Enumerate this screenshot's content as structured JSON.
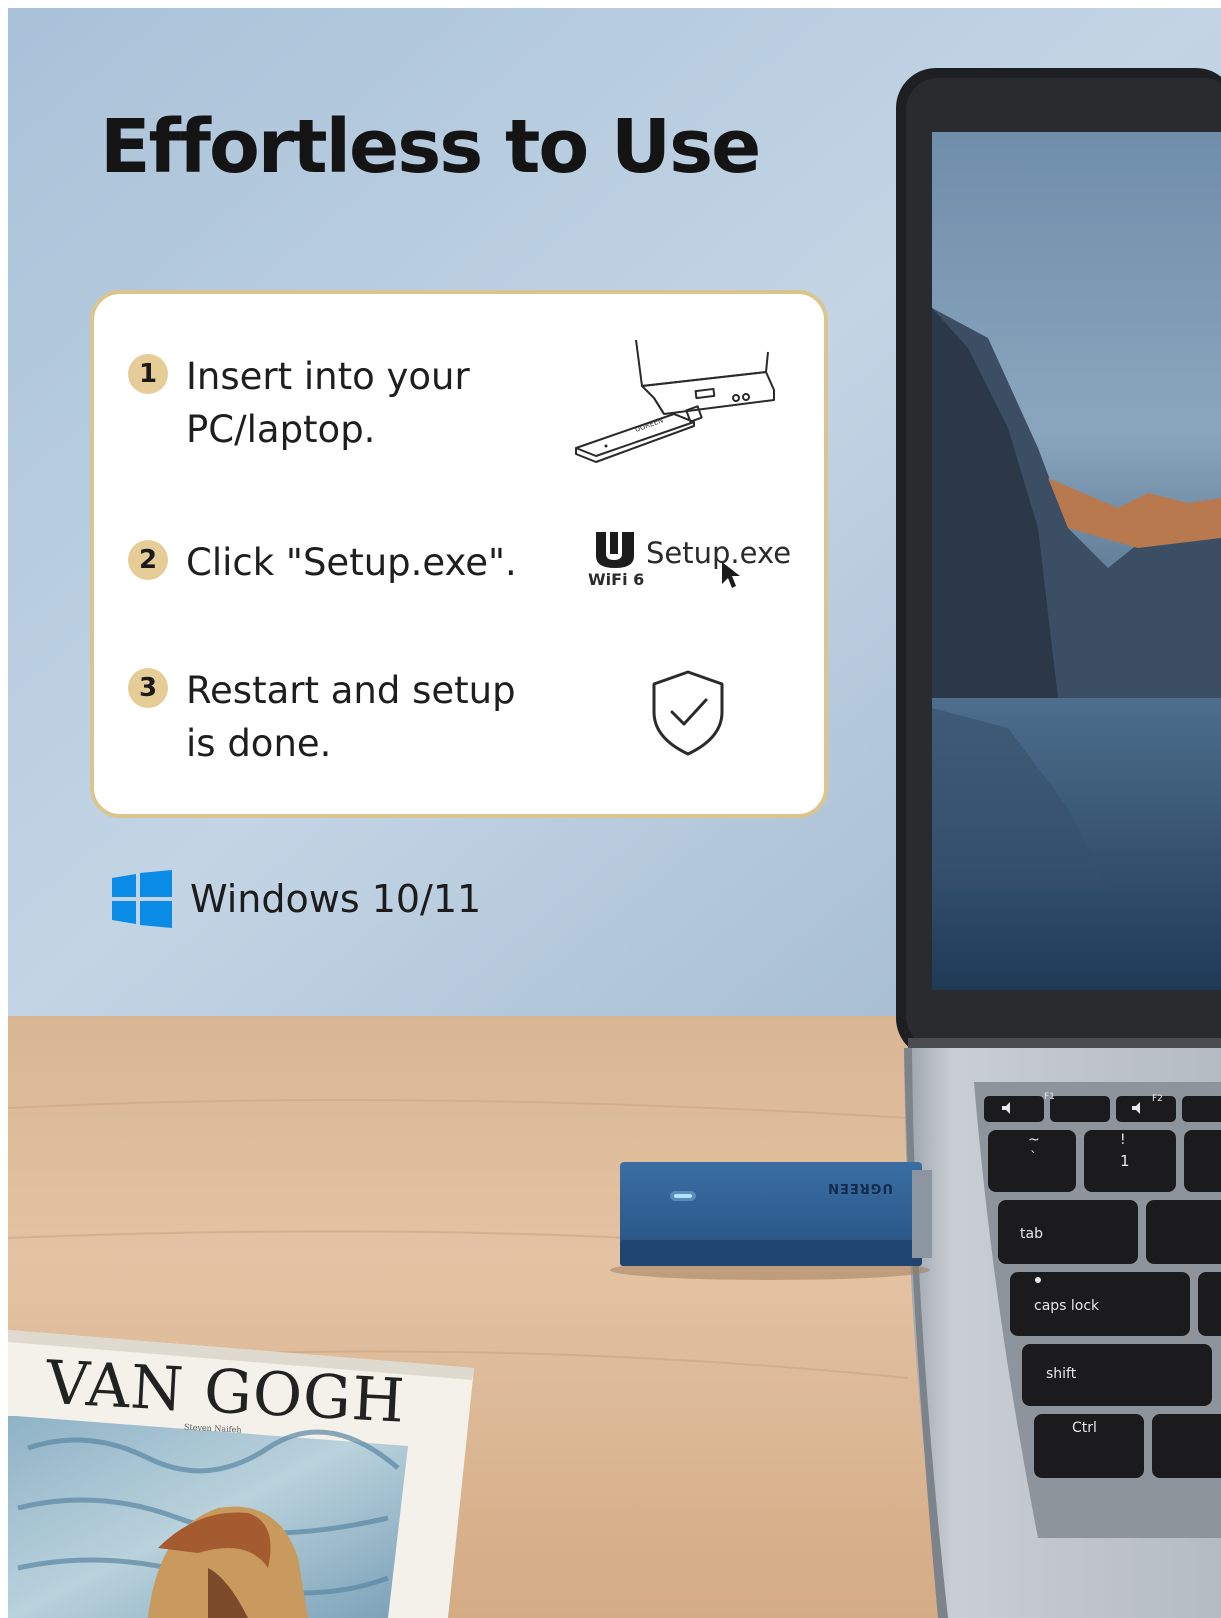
{
  "headline": "Effortless to Use",
  "steps": [
    {
      "number": "1",
      "text": "Insert into your PC/laptop.",
      "icon": "laptop-usb-illustration"
    },
    {
      "number": "2",
      "text": "Click \"Setup.exe\".",
      "icon": "setup-exe-illustration"
    },
    {
      "number": "3",
      "text": "Restart and setup is done.",
      "icon": "shield-check-icon"
    }
  ],
  "setup_icon": {
    "logo_text": "WiFi 6",
    "file_name": "Setup.exe"
  },
  "os": {
    "label": "Windows 10/11",
    "icon": "windows-logo-icon"
  },
  "adapter": {
    "brand": "UGREEN"
  },
  "keyboard": {
    "keys": {
      "f1": "F1",
      "f2": "F2",
      "tilde": "~",
      "backtick": "`",
      "exclam": "!",
      "one": "1",
      "tab": "tab",
      "caps": "caps lock",
      "shift": "shift",
      "ctrl": "Ctrl"
    }
  },
  "book": {
    "title": "VAN GOGH",
    "author": "Steven Naifeh"
  },
  "colors": {
    "wall": "#b9cde0",
    "desk": "#dcb795",
    "card_border": "#dcc48f",
    "number_badge": "#e6cd97",
    "adapter": "#2d5c8e",
    "windows_blue": "#0a8be6"
  }
}
